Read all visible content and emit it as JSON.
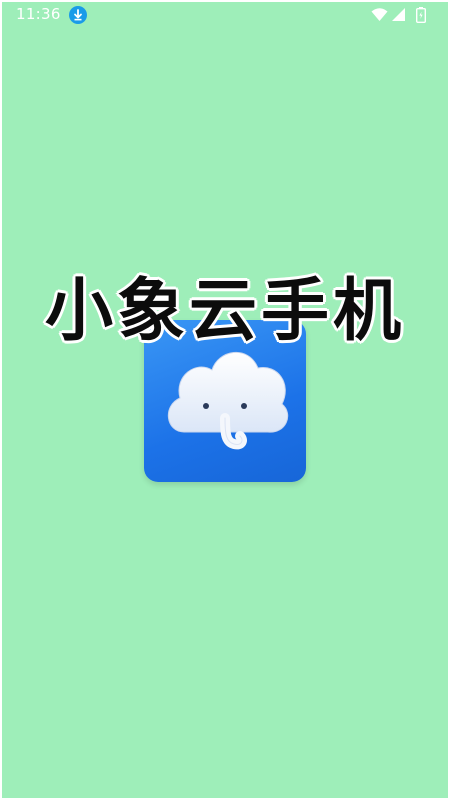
{
  "status_bar": {
    "time": "11:36",
    "icons": [
      "download-icon",
      "wifi-icon",
      "signal-icon",
      "battery-icon"
    ]
  },
  "splash": {
    "app_name": "小象云手机",
    "logo": "cloud-elephant-icon"
  },
  "colors": {
    "background": "#9eeeb9",
    "icon_blue": "#1c72e8",
    "download_badge": "#1a9be8"
  }
}
